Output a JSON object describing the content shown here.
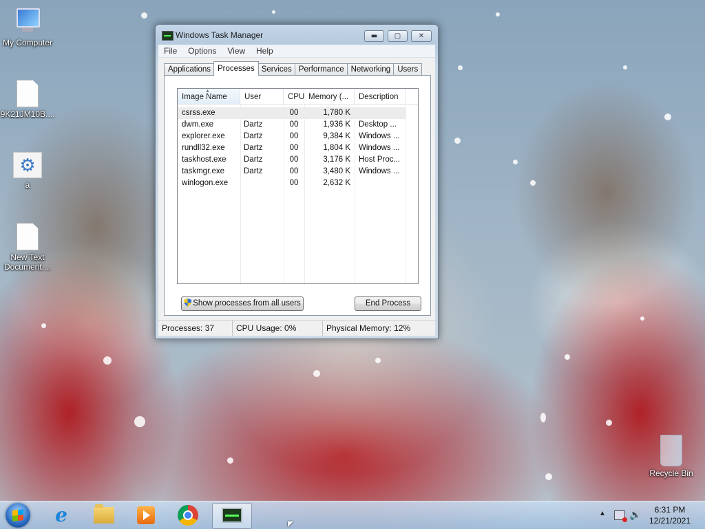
{
  "desktop": {
    "icons": [
      {
        "label": "My Computer",
        "icon": "computer-icon"
      },
      {
        "label": "9K21JM10B....",
        "icon": "document-icon"
      },
      {
        "label": "a",
        "icon": "settings-icon"
      },
      {
        "label_line1": "New Text",
        "label_line2": "Document....",
        "icon": "text-document-icon"
      },
      {
        "label": "Recycle Bin",
        "icon": "recycle-bin-icon"
      }
    ]
  },
  "window": {
    "title": "Windows Task Manager",
    "controls": {
      "minimize": "▬",
      "maximize": "▢",
      "close": "✕"
    },
    "menu": [
      "File",
      "Options",
      "View",
      "Help"
    ],
    "tabs": [
      "Applications",
      "Processes",
      "Services",
      "Performance",
      "Networking",
      "Users"
    ],
    "active_tab": "Processes",
    "columns": [
      "Image Name",
      "User Name",
      "CPU",
      "Memory (...",
      "Description"
    ],
    "sort_indicator": "▲",
    "processes": [
      {
        "image": "csrss.exe",
        "user": "",
        "cpu": "00",
        "memory": "1,780 K",
        "description": ""
      },
      {
        "image": "dwm.exe",
        "user": "Dartz",
        "cpu": "00",
        "memory": "1,936 K",
        "description": "Desktop ..."
      },
      {
        "image": "explorer.exe",
        "user": "Dartz",
        "cpu": "00",
        "memory": "9,384 K",
        "description": "Windows ..."
      },
      {
        "image": "rundll32.exe",
        "user": "Dartz",
        "cpu": "00",
        "memory": "1,804 K",
        "description": "Windows ..."
      },
      {
        "image": "taskhost.exe",
        "user": "Dartz",
        "cpu": "00",
        "memory": "3,176 K",
        "description": "Host Proc..."
      },
      {
        "image": "taskmgr.exe",
        "user": "Dartz",
        "cpu": "00",
        "memory": "3,480 K",
        "description": "Windows ..."
      },
      {
        "image": "winlogon.exe",
        "user": "",
        "cpu": "00",
        "memory": "2,632 K",
        "description": ""
      }
    ],
    "buttons": {
      "show_all": "Show processes from all users",
      "end_process": "End Process"
    },
    "status": {
      "processes": "Processes: 37",
      "cpu": "CPU Usage: 0%",
      "memory": "Physical Memory: 12%"
    }
  },
  "taskbar": {
    "apps": [
      "internet-explorer-icon",
      "file-explorer-icon",
      "media-player-icon",
      "chrome-icon",
      "task-manager-icon"
    ],
    "tray": {
      "show_hidden": "▲",
      "volume": "🔊"
    },
    "clock": {
      "time": "6:31 PM",
      "date": "12/21/2021"
    }
  }
}
